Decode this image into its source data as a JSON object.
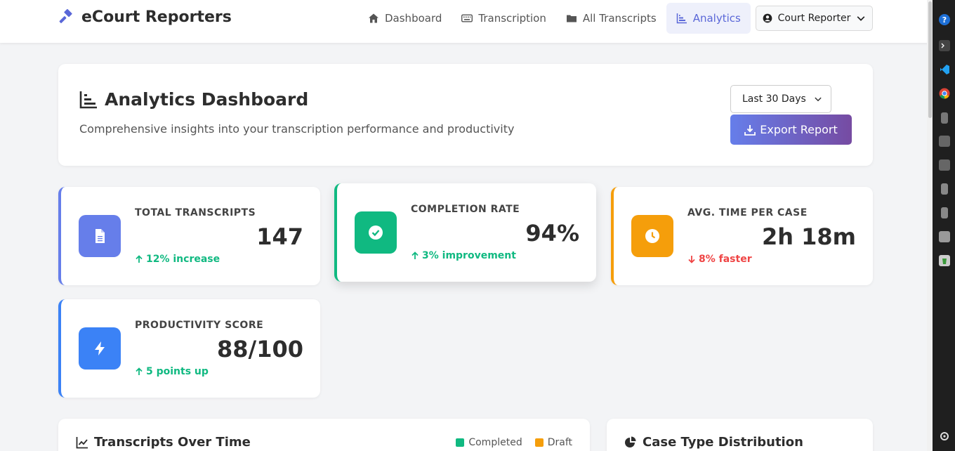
{
  "brand": {
    "name": "eCourt Reporters",
    "icon": "gavel-icon"
  },
  "nav": {
    "items": [
      {
        "label": "Dashboard",
        "icon": "home-icon",
        "active": false
      },
      {
        "label": "Transcription",
        "icon": "keyboard-icon",
        "active": false
      },
      {
        "label": "All Transcripts",
        "icon": "folder-icon",
        "active": false
      },
      {
        "label": "Analytics",
        "icon": "bar-chart-icon",
        "active": true
      }
    ],
    "user": {
      "label": "Court Reporter",
      "icon": "user-circle-icon"
    }
  },
  "header": {
    "title": "Analytics Dashboard",
    "subtitle": "Comprehensive insights into your transcription performance and productivity",
    "range": {
      "selected": "Last 30 Days"
    },
    "export_label": "Export Report"
  },
  "stats": [
    {
      "label": "Total Transcripts",
      "value": "147",
      "change": "12% increase",
      "direction": "up",
      "accent": "#667eea",
      "icon": "file-icon"
    },
    {
      "label": "Completion Rate",
      "value": "94%",
      "change": "3% improvement",
      "direction": "up",
      "accent": "#10b981",
      "icon": "check-circle-icon"
    },
    {
      "label": "Avg. Time Per Case",
      "value": "2h 18m",
      "change": "8% faster",
      "direction": "down",
      "accent": "#f59e0b",
      "icon": "clock-icon"
    },
    {
      "label": "Productivity Score",
      "value": "88/100",
      "change": "5 points up",
      "direction": "up",
      "accent": "#3b82f6",
      "icon": "bolt-icon"
    }
  ],
  "charts": {
    "over_time": {
      "title": "Transcripts Over Time",
      "icon": "line-chart-icon",
      "legend": [
        {
          "label": "Completed",
          "color": "#10b981"
        },
        {
          "label": "Draft",
          "color": "#f59e0b"
        }
      ]
    },
    "case_type": {
      "title": "Case Type Distribution",
      "icon": "pie-chart-icon"
    }
  },
  "colors": {
    "up": "#10b981",
    "down": "#ef4444",
    "brand": "#5a67d8"
  }
}
